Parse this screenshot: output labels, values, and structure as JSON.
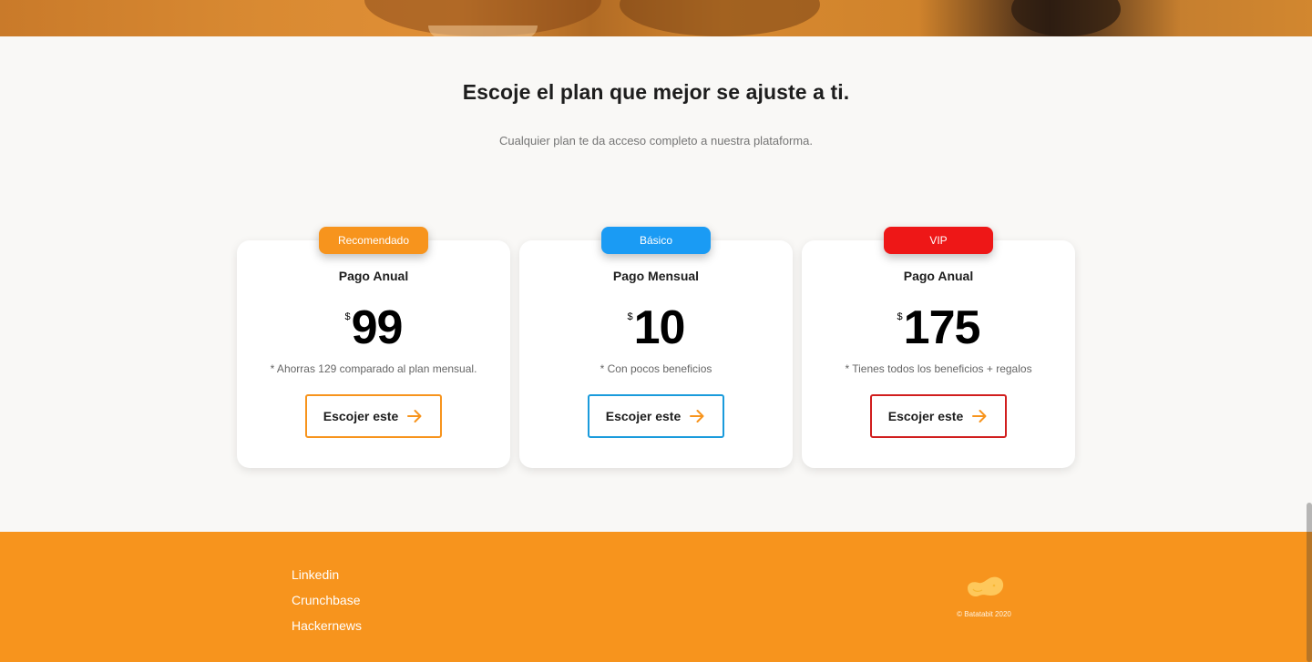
{
  "pricing": {
    "title": "Escoje el plan que mejor se ajuste a ti.",
    "subtitle": "Cualquier plan te da acceso completo a nuestra plataforma.",
    "plans": [
      {
        "badge": "Recomendado",
        "badge_color": "#f7941d",
        "name": "Pago Anual",
        "currency": "$",
        "price": "99",
        "note": "* Ahorras 129 comparado al plan mensual.",
        "cta": "Escojer este",
        "border_color": "#f7941d"
      },
      {
        "badge": "Básico",
        "badge_color": "#1a9bf4",
        "name": "Pago Mensual",
        "currency": "$",
        "price": "10",
        "note": "* Con pocos beneficios",
        "cta": "Escojer este",
        "border_color": "#1a9bdc"
      },
      {
        "badge": "VIP",
        "badge_color": "#ee1717",
        "name": "Pago Anual",
        "currency": "$",
        "price": "175",
        "note": "* Tienes todos los beneficios + regalos",
        "cta": "Escojer este",
        "border_color": "#d11e1e"
      }
    ],
    "arrow_icon": "arrow-right-icon",
    "arrow_color": "#f7941d"
  },
  "footer": {
    "links": [
      "Linkedin",
      "Crunchbase",
      "Hackernews"
    ],
    "logo_icon": "batatabit-logo-icon",
    "copyright": "© Batatabit 2020",
    "background": "#f7941d"
  }
}
